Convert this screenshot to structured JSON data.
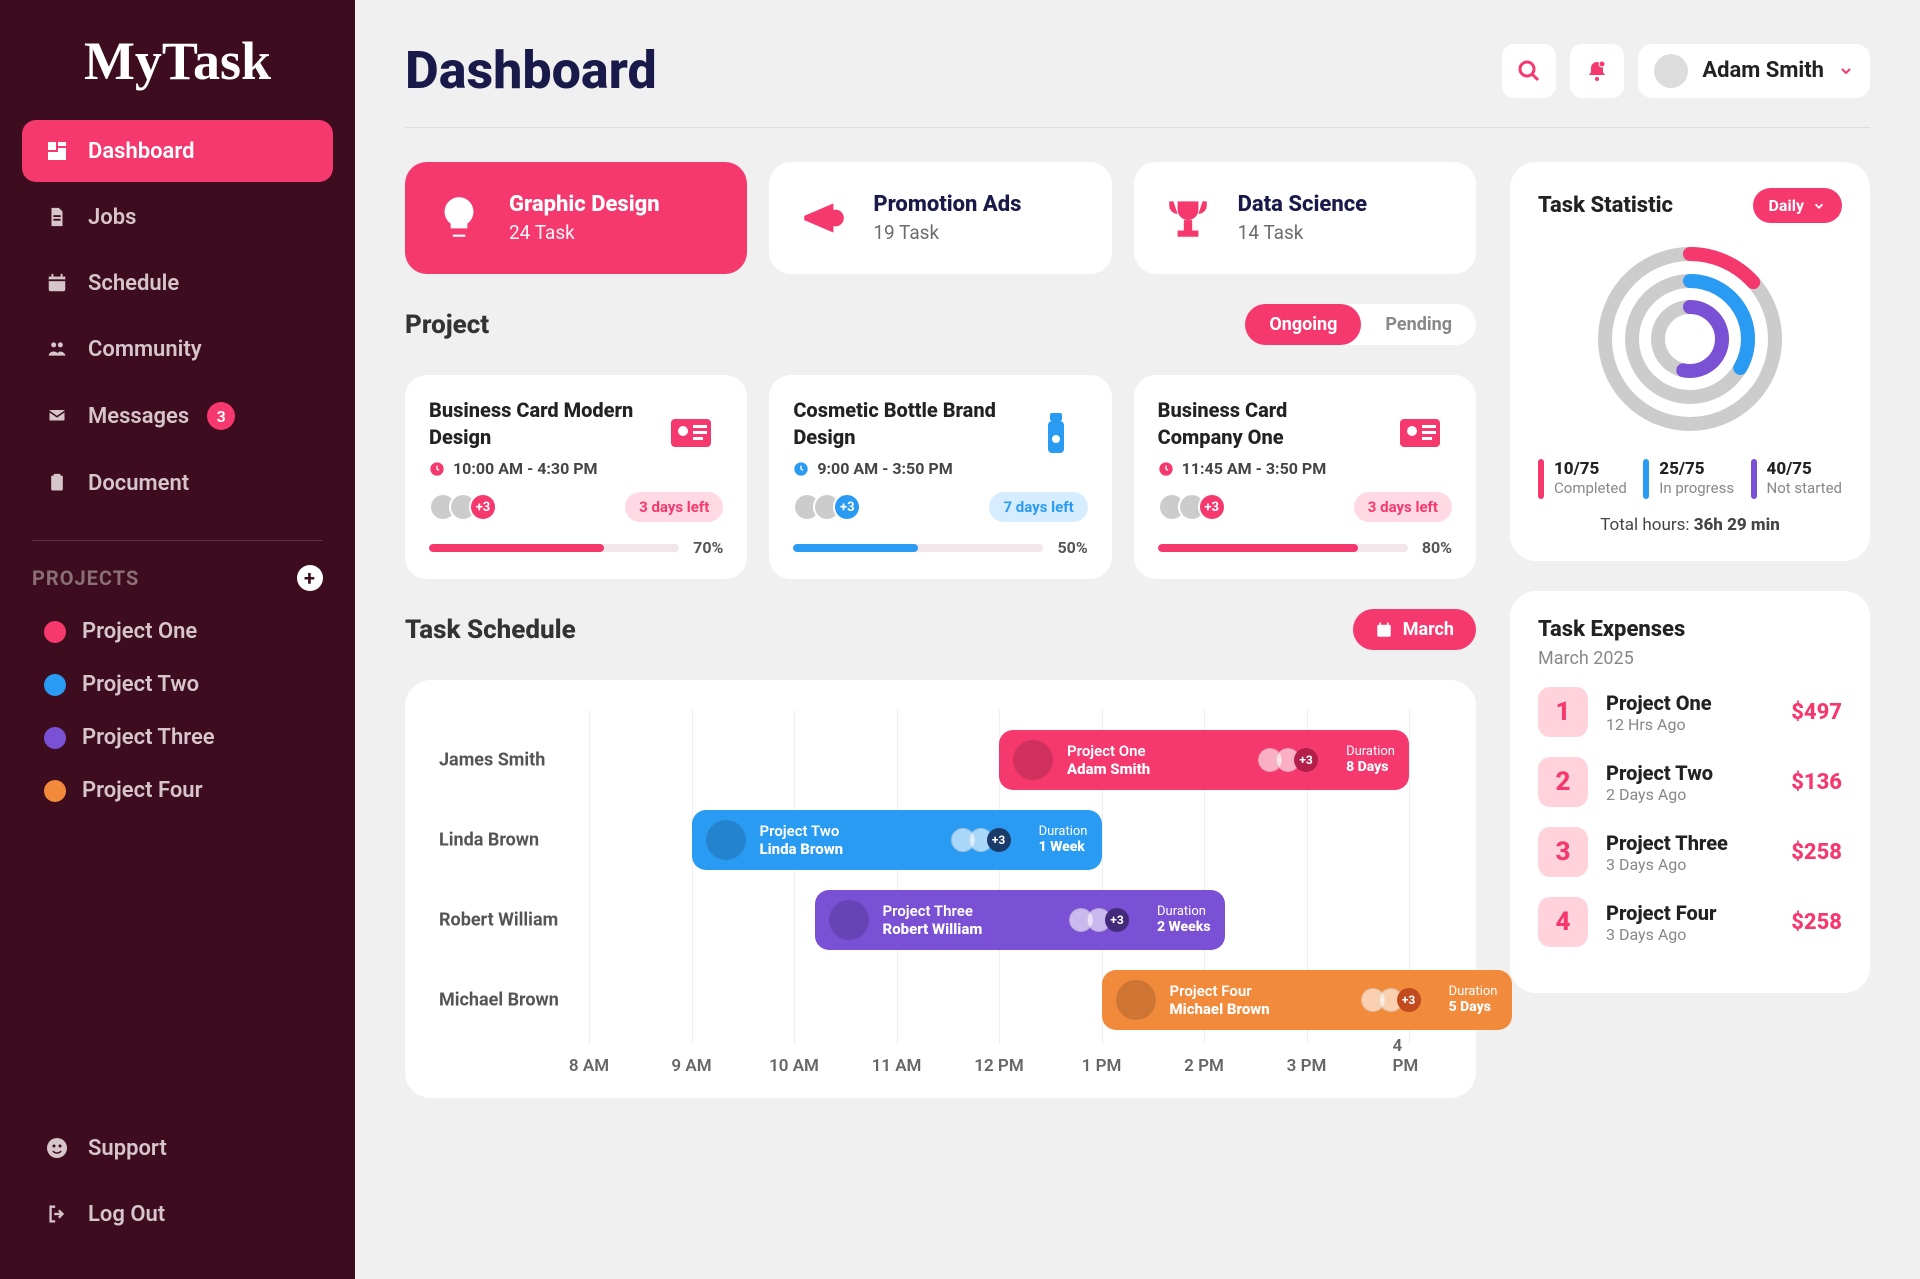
{
  "brand": "MyTask",
  "sidebar": {
    "nav": [
      {
        "label": "Dashboard"
      },
      {
        "label": "Jobs"
      },
      {
        "label": "Schedule"
      },
      {
        "label": "Community"
      },
      {
        "label": "Messages",
        "badge": "3"
      },
      {
        "label": "Document"
      }
    ],
    "projects_header": "PROJECTS",
    "projects": [
      {
        "label": "Project One",
        "color": "#f5396e"
      },
      {
        "label": "Project Two",
        "color": "#2a9bf2"
      },
      {
        "label": "Project Three",
        "color": "#7a50d5"
      },
      {
        "label": "Project Four",
        "color": "#f28a3c"
      }
    ],
    "bottom": [
      {
        "label": "Support"
      },
      {
        "label": "Log Out"
      }
    ]
  },
  "header": {
    "title": "Dashboard",
    "user_name": "Adam Smith"
  },
  "stat_cards": [
    {
      "title": "Graphic Design",
      "task_count": "24 Task"
    },
    {
      "title": "Promotion Ads",
      "task_count": "19 Task"
    },
    {
      "title": "Data Science",
      "task_count": "14 Task"
    }
  ],
  "project_section": {
    "title": "Project",
    "tabs": {
      "ongoing": "Ongoing",
      "pending": "Pending"
    },
    "cards": [
      {
        "title": "Business Card Modern Design",
        "time": "10:00 AM - 4:30 PM",
        "more": "+3",
        "days_left": "3 days left",
        "chip": "pink",
        "pct": 70,
        "color": "#f5396e",
        "icon": "card"
      },
      {
        "title": "Cosmetic Bottle Brand Design",
        "time": "9:00 AM - 3:50 PM",
        "more": "+3",
        "days_left": "7 days left",
        "chip": "blue",
        "pct": 50,
        "color": "#2a9bf2",
        "icon": "bottle"
      },
      {
        "title": "Business Card Company One",
        "time": "11:45 AM - 3:50 PM",
        "more": "+3",
        "days_left": "3 days left",
        "chip": "pink",
        "pct": 80,
        "color": "#f5396e",
        "icon": "card"
      }
    ]
  },
  "schedule": {
    "title": "Task Schedule",
    "month_btn": "March",
    "times": [
      "8 AM",
      "9 AM",
      "10 AM",
      "11 AM",
      "12 PM",
      "1 PM",
      "2 PM",
      "3 PM",
      "4 PM"
    ],
    "rows": [
      {
        "person": "James Smith",
        "project": "Project One",
        "name": "Adam Smith",
        "more": "+3",
        "duration_label": "Duration",
        "duration": "8 Days",
        "color": "#f5396e",
        "more_bg": "#b31f4b",
        "start_col": 4,
        "span_cols": 4
      },
      {
        "person": "Linda Brown",
        "project": "Project Two",
        "name": "Linda Brown",
        "more": "+3",
        "duration_label": "Duration",
        "duration": "1 Week",
        "color": "#2a9bf2",
        "more_bg": "#1a3a6a",
        "start_col": 1,
        "span_cols": 4
      },
      {
        "person": "Robert William",
        "project": "Project Three",
        "name": "Robert William",
        "more": "+3",
        "duration_label": "Duration",
        "duration": "2 Weeks",
        "color": "#7a50d5",
        "more_bg": "#432a7a",
        "start_col": 2.2,
        "span_cols": 4
      },
      {
        "person": "Michael Brown",
        "project": "Project Four",
        "name": "Michael Brown",
        "more": "+3",
        "duration_label": "Duration",
        "duration": "5 Days",
        "color": "#f28a3c",
        "more_bg": "#c24a1f",
        "start_col": 5,
        "span_cols": 4
      }
    ]
  },
  "task_stat": {
    "title": "Task Statistic",
    "selector": "Daily",
    "legend": [
      {
        "value": "10/75",
        "label": "Completed",
        "color": "#f5396e"
      },
      {
        "value": "25/75",
        "label": "In progress",
        "color": "#2a9bf2"
      },
      {
        "value": "40/75",
        "label": "Not started",
        "color": "#7a50d5"
      }
    ],
    "total_label": "Total hours:",
    "total_value": "36h 29 min"
  },
  "expenses": {
    "title": "Task Expenses",
    "month": "March 2025",
    "items": [
      {
        "num": "1",
        "name": "Project One",
        "time": "12 Hrs Ago",
        "amt": "$497"
      },
      {
        "num": "2",
        "name": "Project Two",
        "time": "2 Days Ago",
        "amt": "$136"
      },
      {
        "num": "3",
        "name": "Project Three",
        "time": "3 Days Ago",
        "amt": "$258"
      },
      {
        "num": "4",
        "name": "Project Four",
        "time": "3 Days Ago",
        "amt": "$258"
      }
    ]
  },
  "chart_data": {
    "type": "pie",
    "title": "Task Statistic",
    "series": [
      {
        "name": "Completed",
        "value": 10,
        "total": 75,
        "color": "#f5396e"
      },
      {
        "name": "In progress",
        "value": 25,
        "total": 75,
        "color": "#2a9bf2"
      },
      {
        "name": "Not started",
        "value": 40,
        "total": 75,
        "color": "#7a50d5"
      }
    ]
  }
}
